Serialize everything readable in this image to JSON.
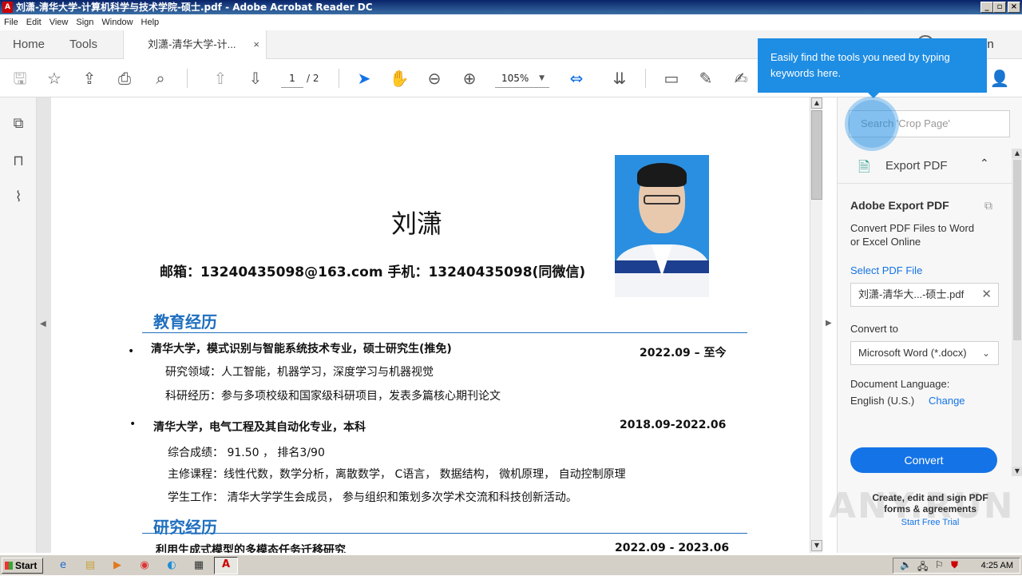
{
  "window": {
    "title": "刘潇-清华大学-计算机科学与技术学院-硕士.pdf - Adobe Acrobat Reader DC",
    "app_icon": "acrobat-icon"
  },
  "menu": [
    "File",
    "Edit",
    "View",
    "Sign",
    "Window",
    "Help"
  ],
  "tabs": {
    "home": "Home",
    "tools": "Tools",
    "document": "刘潇-清华大学-计...",
    "close": "×"
  },
  "header_right": {
    "sign_in": "Sign In"
  },
  "toolbar": {
    "page_current": "1",
    "page_total": "/ 2",
    "zoom": "105%"
  },
  "tooltip": {
    "text": "Easily find the tools you need by typing keywords here."
  },
  "right_pane": {
    "search_placeholder": "Search 'Crop Page'",
    "export_header": "Export PDF",
    "title": "Adobe Export PDF",
    "description": "Convert PDF Files to Word or Excel Online",
    "select_label": "Select PDF File",
    "file_name": "刘潇-清华大...-硕士.pdf",
    "convert_to_label": "Convert to",
    "convert_format": "Microsoft Word (*.docx)",
    "doc_lang_label": "Document Language:",
    "doc_lang_value": "English (U.S.)",
    "change_link": "Change",
    "convert_button": "Convert",
    "promo_line1": "Create, edit and sign PDF",
    "promo_line2": "forms & agreements",
    "promo_link": "Start Free Trial",
    "watermark": "ANY.RUN"
  },
  "document": {
    "name": "刘潇",
    "contact": "邮箱：13240435098@163.com   手机：13240435098(同微信)",
    "education_title": "教育经历",
    "edu1": {
      "school": "清华大学，模式识别与智能系统技术专业，硕士研究生(推免)",
      "date": "2022.09 – 至今",
      "line1": "研究领域：人工智能，机器学习，深度学习与机器视觉",
      "line2": "科研经历：参与多项校级和国家级科研项目，发表多篇核心期刊论文"
    },
    "edu2": {
      "school": "清华大学，电气工程及其自动化专业，本科",
      "date": "2018.09-2022.06",
      "line1": "综合成绩： 91.50 ， 排名3/90",
      "line2": "主修课程：线性代数，数学分析，离散数学， C语言， 数据结构， 微机原理， 自动控制原理",
      "line3": "学生工作： 清华大学学生会成员， 参与组织和策划多次学术交流和科技创新活动。"
    },
    "research_title": "研究经历",
    "research1": {
      "title": "利用生成式模型的多模态任务迁移研究",
      "date": "2022.09 - 2023.06"
    }
  },
  "taskbar": {
    "start": "Start",
    "clock": "4:25 AM"
  },
  "colors": {
    "accent": "#1473e6",
    "tooltip": "#1e8de4",
    "section": "#1f6fbf"
  }
}
